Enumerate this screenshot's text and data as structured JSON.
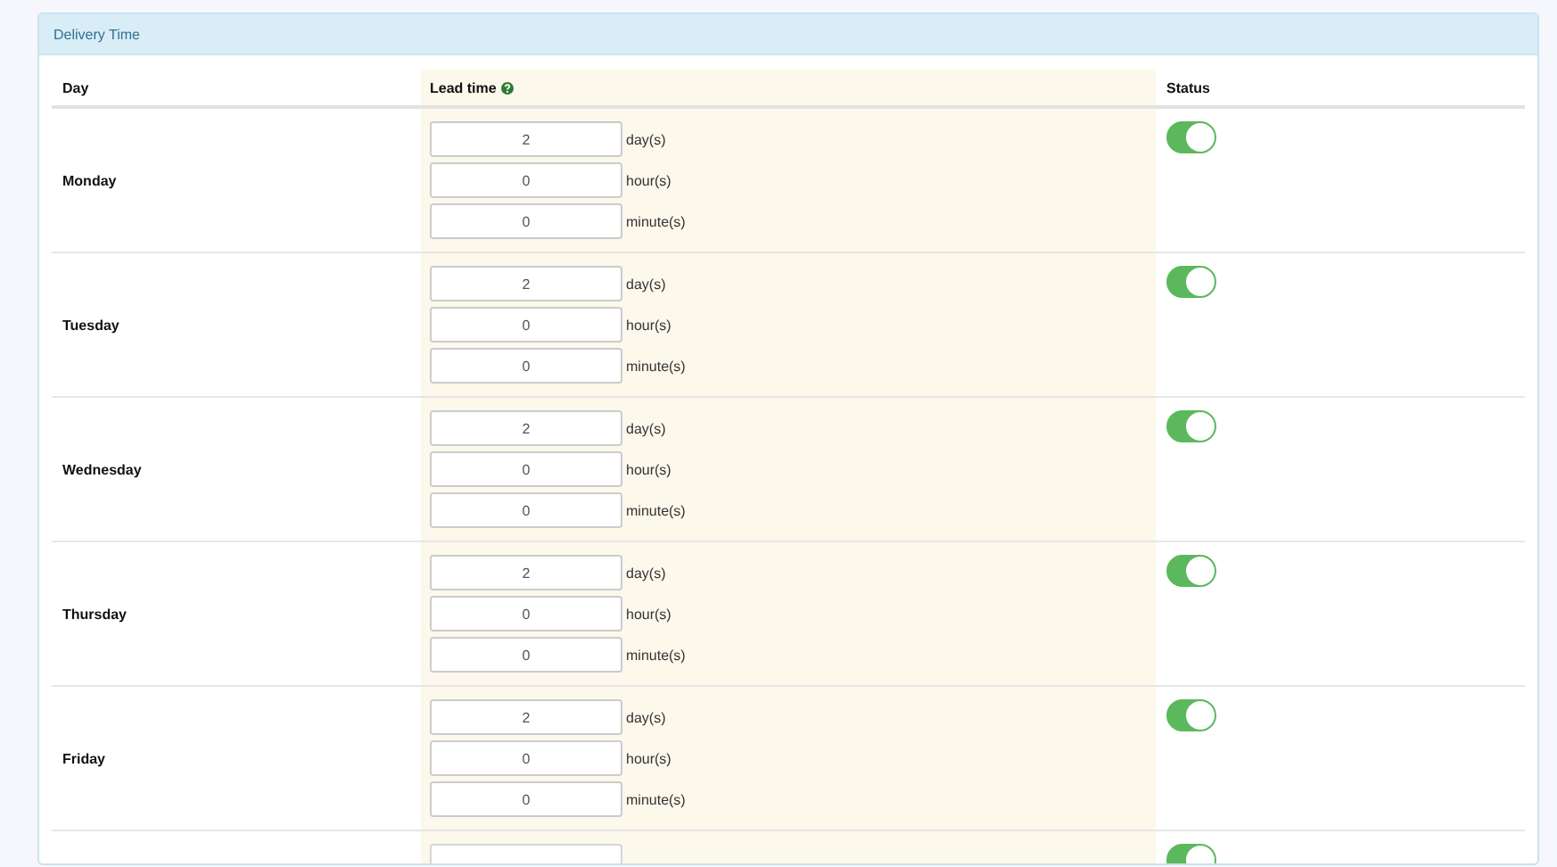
{
  "panel": {
    "title": "Delivery Time"
  },
  "table": {
    "columns": [
      {
        "label": "Day",
        "help": false
      },
      {
        "label": "Lead time",
        "help": true
      },
      {
        "label": "Status",
        "help": false
      }
    ],
    "rows": [
      {
        "day": "Monday",
        "enabled": true,
        "fields": [
          {
            "value": "2",
            "unit": "day(s)"
          },
          {
            "value": "0",
            "unit": "hour(s)"
          },
          {
            "value": "0",
            "unit": "minute(s)"
          }
        ]
      },
      {
        "day": "Tuesday",
        "enabled": true,
        "fields": [
          {
            "value": "2",
            "unit": "day(s)"
          },
          {
            "value": "0",
            "unit": "hour(s)"
          },
          {
            "value": "0",
            "unit": "minute(s)"
          }
        ]
      },
      {
        "day": "Wednesday",
        "enabled": true,
        "fields": [
          {
            "value": "2",
            "unit": "day(s)"
          },
          {
            "value": "0",
            "unit": "hour(s)"
          },
          {
            "value": "0",
            "unit": "minute(s)"
          }
        ]
      },
      {
        "day": "Thursday",
        "enabled": true,
        "fields": [
          {
            "value": "2",
            "unit": "day(s)"
          },
          {
            "value": "0",
            "unit": "hour(s)"
          },
          {
            "value": "0",
            "unit": "minute(s)"
          }
        ]
      },
      {
        "day": "Friday",
        "enabled": true,
        "fields": [
          {
            "value": "2",
            "unit": "day(s)"
          },
          {
            "value": "0",
            "unit": "hour(s)"
          },
          {
            "value": "0",
            "unit": "minute(s)"
          }
        ]
      },
      {
        "enabled": true,
        "fields": [
          {
            "kind": "cut"
          }
        ]
      }
    ]
  }
}
